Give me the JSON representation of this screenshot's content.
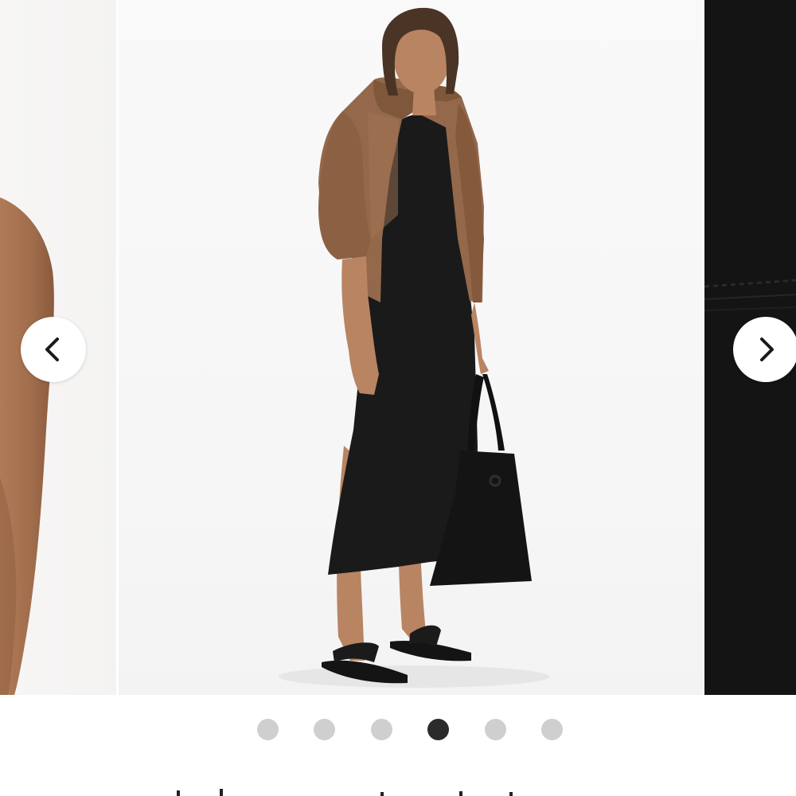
{
  "carousel": {
    "slides": [
      {
        "role": "previous",
        "subject": "bare-shoulder-photo"
      },
      {
        "role": "current",
        "subject": "model-in-black-dress-and-brown-jacket"
      },
      {
        "role": "next",
        "subject": "black-fabric-closeup"
      }
    ],
    "prev_icon": "chevron-left-icon",
    "next_icon": "chevron-right-icon",
    "pagination": {
      "total": 6,
      "active_index": 3
    },
    "colors": {
      "dot_inactive": "#cfcfcf",
      "dot_active": "#2b2b2b",
      "nav_button_bg": "#ffffff",
      "jacket": "#94684a",
      "dress": "#1a1a1a"
    }
  }
}
